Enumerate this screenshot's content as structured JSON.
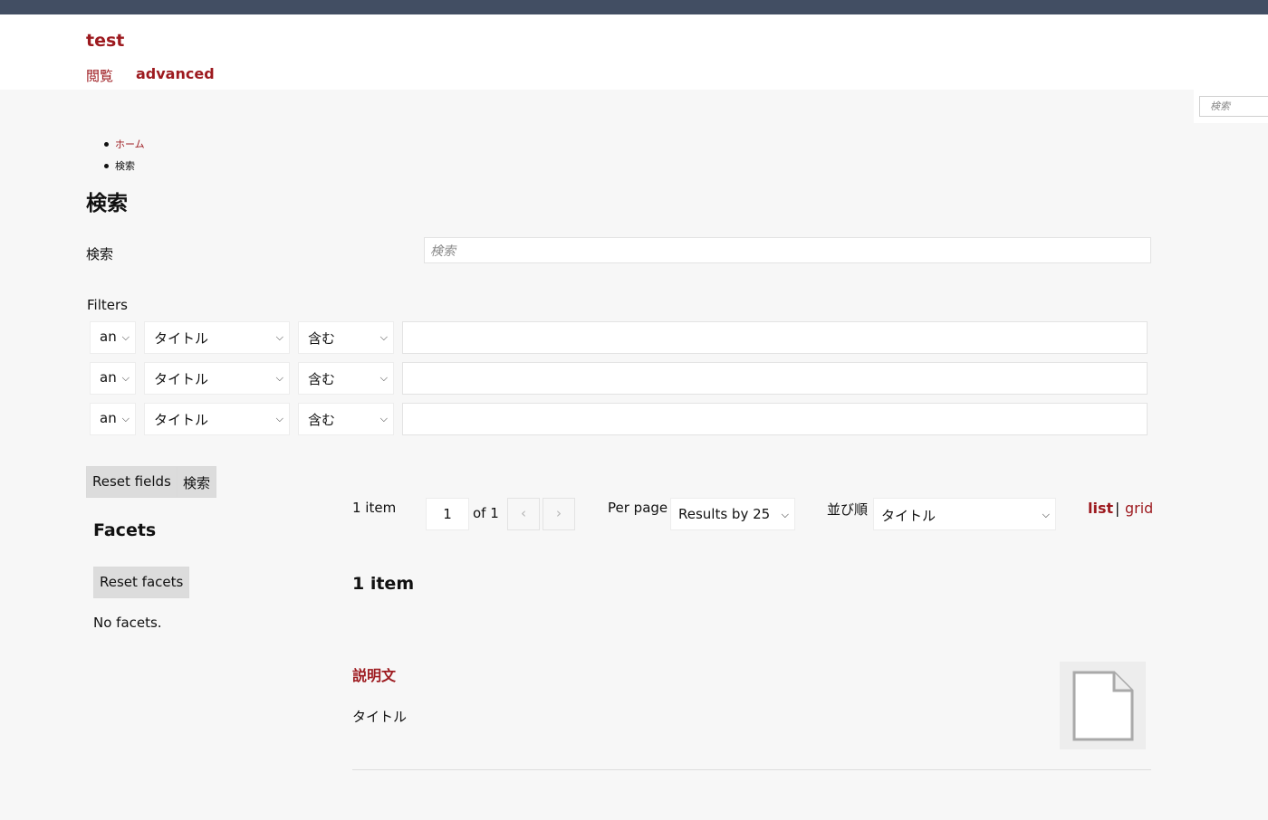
{
  "header": {
    "site_title": "test",
    "nav": {
      "browse": "閲覧",
      "advanced": "advanced"
    }
  },
  "side_search": {
    "placeholder": "検索"
  },
  "breadcrumb": {
    "home": "ホーム",
    "current": "検索"
  },
  "page": {
    "title": "検索"
  },
  "search": {
    "label": "検索",
    "placeholder": "検索"
  },
  "filters": {
    "label": "Filters",
    "rows": [
      {
        "join": "an",
        "field": "タイトル",
        "operator": "含む",
        "value": ""
      },
      {
        "join": "an",
        "field": "タイトル",
        "operator": "含む",
        "value": ""
      },
      {
        "join": "an",
        "field": "タイトル",
        "operator": "含む",
        "value": ""
      }
    ]
  },
  "buttons": {
    "reset_fields": "Reset fields",
    "search": "検索"
  },
  "facets": {
    "heading": "Facets",
    "reset": "Reset facets",
    "empty": "No facets."
  },
  "results_bar": {
    "count": "1 item",
    "page": "1",
    "of": "of 1",
    "per_page_label": "Per page",
    "per_page_value": "Results by 25",
    "sort_label": "並び順",
    "sort_value": "タイトル",
    "view_list": "list",
    "view_sep": "|",
    "view_grid": "grid"
  },
  "results": {
    "heading": "1 item",
    "items": [
      {
        "title": "説明文",
        "meta": "タイトル",
        "thumbnail_icon": "file-icon"
      }
    ]
  },
  "colors": {
    "accent": "#9d1a1f",
    "topbar": "#424e63",
    "background": "#f7f7f7"
  }
}
